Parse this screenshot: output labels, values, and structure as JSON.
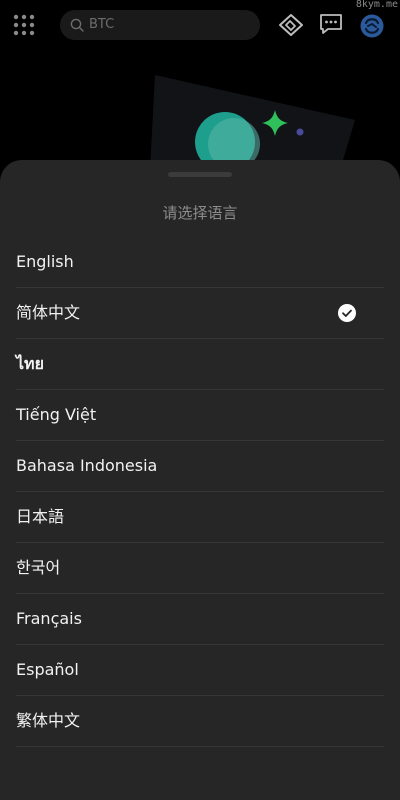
{
  "header": {
    "search_placeholder": "BTC",
    "watermark": "8kym.me",
    "icons": [
      "grid-menu-icon",
      "search-icon",
      "handshake-icon",
      "chat-icon",
      "avatar-icon"
    ]
  },
  "language_sheet": {
    "title": "请选择语言",
    "selected_index": 1,
    "items": [
      {
        "label": "English",
        "selected": false
      },
      {
        "label": "简体中文",
        "selected": true
      },
      {
        "label": "ไทย",
        "selected": false
      },
      {
        "label": "Tiếng Việt",
        "selected": false
      },
      {
        "label": "Bahasa Indonesia",
        "selected": false
      },
      {
        "label": "日本語",
        "selected": false
      },
      {
        "label": "한국어",
        "selected": false
      },
      {
        "label": "Français",
        "selected": false
      },
      {
        "label": "Español",
        "selected": false
      },
      {
        "label": "繁体中文",
        "selected": false
      }
    ]
  },
  "colors": {
    "background": "#000000",
    "sheet": "#262626",
    "divider": "#363636",
    "text": "#f2f2f2",
    "title": "#8c8c8c",
    "accent_teal": "#1e9e8c",
    "accent_green": "#2fbf5b",
    "avatar_blue": "#2a5a9a"
  }
}
